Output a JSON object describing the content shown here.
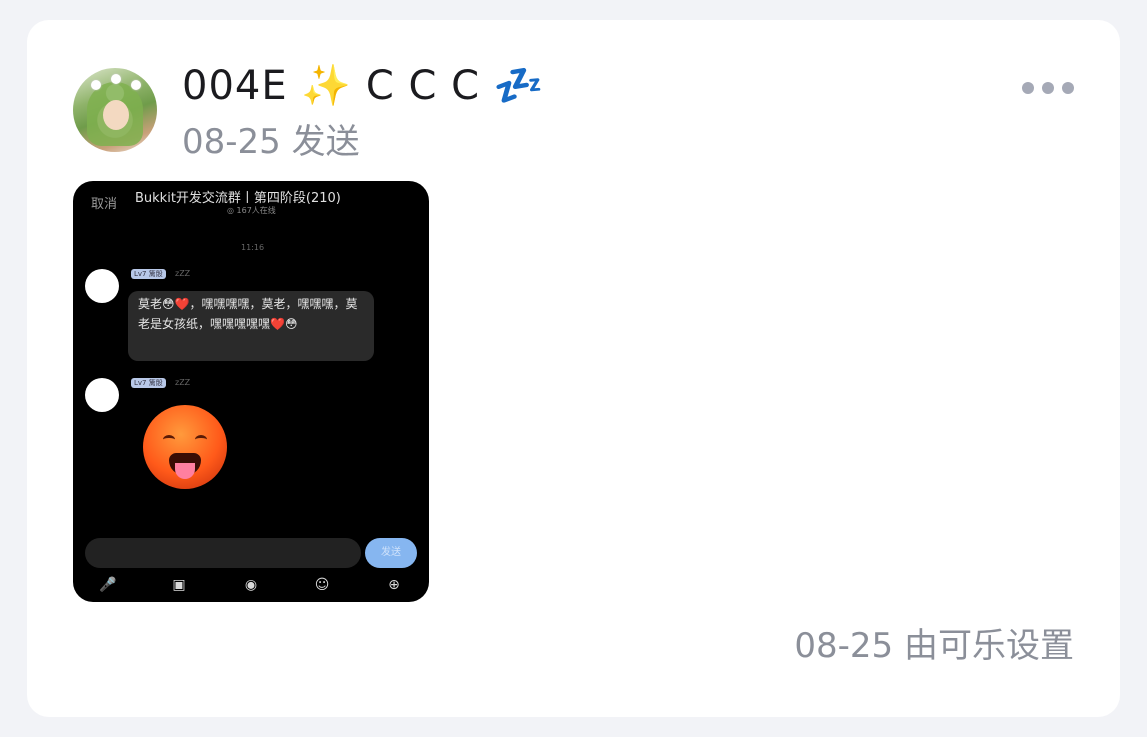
{
  "post": {
    "author_name": "004E ✨ C C C 💤",
    "meta": "08-25 发送",
    "footer": "08-25 由可乐设置",
    "more_icon": "ellipsis-icon"
  },
  "screenshot": {
    "cancel": "取消",
    "group_title": "Bukkit开发交流群丨第四阶段(210)",
    "online": "◎ 167人在线",
    "time": "11:16",
    "tag1": "Lv7 篱骰",
    "zz1": "zZZ",
    "message": "莫老😳❤️，嘿嘿嘿嘿，莫老，嘿嘿嘿，莫老是女孩纸，嘿嘿嘿嘿嘿❤️😳",
    "tag2": "Lv7 篱骰",
    "zz2": "zZZ",
    "sticker": "flushed-face-tongue-emoji",
    "send": "发送",
    "tools": [
      "mic-icon",
      "image-icon",
      "camera-icon",
      "emoji-icon",
      "plus-icon"
    ],
    "tool_glyphs": [
      "🎤",
      "▣",
      "◉",
      "☺",
      "⊕"
    ]
  }
}
